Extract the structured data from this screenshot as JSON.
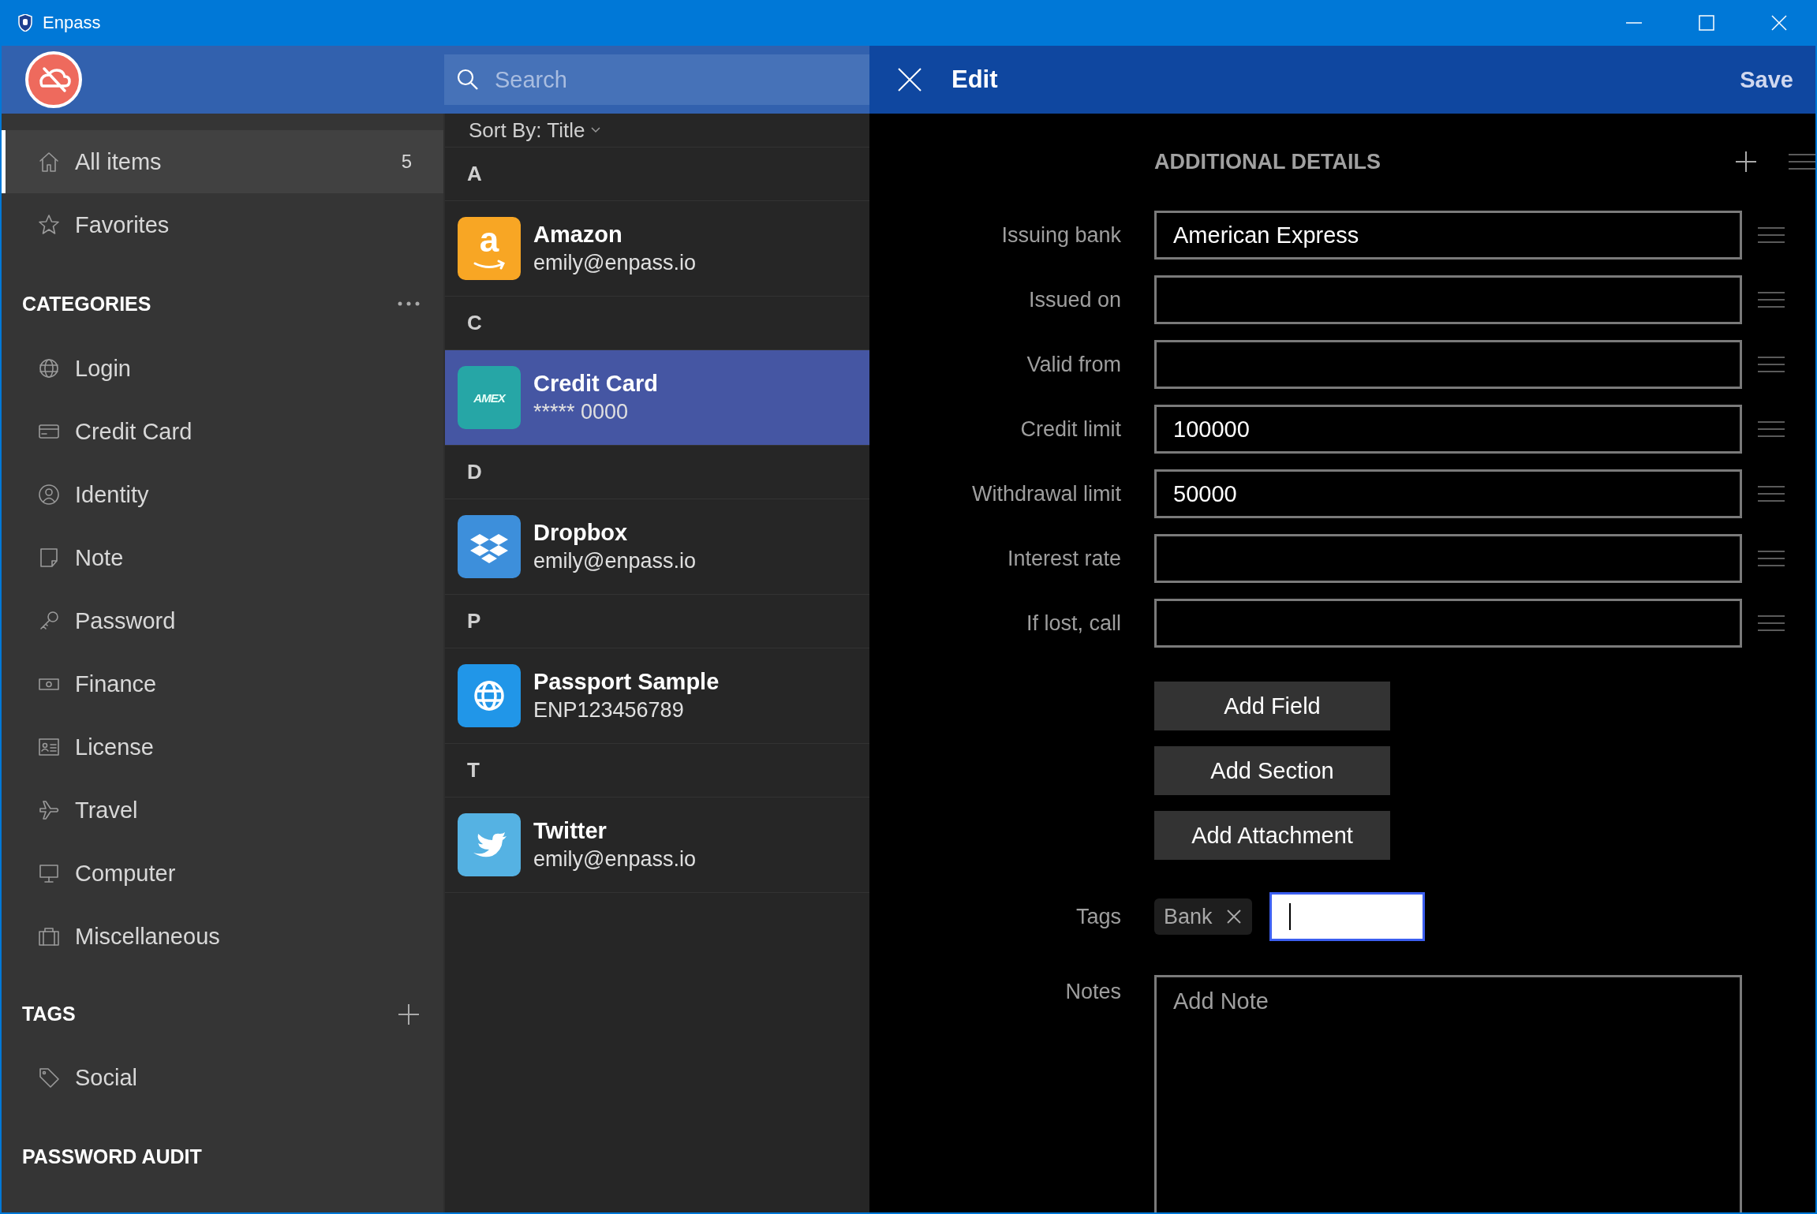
{
  "window": {
    "title": "Enpass"
  },
  "header": {
    "search": {
      "placeholder": "Search"
    }
  },
  "sidebar": {
    "items": [
      {
        "label": "All items",
        "count": "5",
        "selected": true
      },
      {
        "label": "Favorites",
        "selected": false
      }
    ],
    "categories_title": "CATEGORIES",
    "categories": [
      {
        "label": "Login",
        "selected": false
      },
      {
        "label": "Credit Card",
        "selected": false
      },
      {
        "label": "Identity",
        "selected": false
      },
      {
        "label": "Note",
        "selected": false
      },
      {
        "label": "Password",
        "selected": false
      },
      {
        "label": "Finance",
        "selected": false
      },
      {
        "label": "License",
        "selected": false
      },
      {
        "label": "Travel",
        "selected": false
      },
      {
        "label": "Computer",
        "selected": false
      },
      {
        "label": "Miscellaneous",
        "selected": false
      }
    ],
    "tags_title": "TAGS",
    "tags": [
      {
        "label": "Social",
        "selected": false
      }
    ],
    "password_audit_title": "PASSWORD AUDIT"
  },
  "list": {
    "sort": "Sort By: Title",
    "groups": [
      {
        "letter": "A",
        "items": [
          {
            "title": "Amazon",
            "subtitle": "emily@enpass.io",
            "badge_text": "a",
            "color": "#f8a624",
            "selected": false
          }
        ]
      },
      {
        "letter": "C",
        "items": [
          {
            "title": "Credit Card",
            "subtitle": "***** 0000",
            "badge_text": "AMEX",
            "color": "#26a6a6",
            "selected": true
          }
        ]
      },
      {
        "letter": "D",
        "items": [
          {
            "title": "Dropbox",
            "subtitle": "emily@enpass.io",
            "color": "#3d8fdb",
            "selected": false
          }
        ]
      },
      {
        "letter": "P",
        "items": [
          {
            "title": "Passport Sample",
            "subtitle": "ENP123456789",
            "color": "#2196e8",
            "selected": false
          }
        ]
      },
      {
        "letter": "T",
        "items": [
          {
            "title": "Twitter",
            "subtitle": "emily@enpass.io",
            "color": "#55b2e3",
            "selected": false
          }
        ]
      }
    ]
  },
  "edit": {
    "title": "Edit",
    "save": "Save",
    "section_title": "ADDITIONAL DETAILS",
    "fields": [
      {
        "label": "Issuing bank",
        "value": "American Express"
      },
      {
        "label": "Issued on"
      },
      {
        "label": "Valid from"
      },
      {
        "label": "Credit limit",
        "value": "100000"
      },
      {
        "label": "Withdrawal limit",
        "value": "50000"
      },
      {
        "label": "Interest rate"
      },
      {
        "label": "If lost, call"
      }
    ],
    "buttons": [
      "Add Field",
      "Add Section",
      "Add Attachment"
    ],
    "tags": {
      "label": "Tags",
      "chips": [
        "Bank"
      ],
      "input_focused": true
    },
    "notes": {
      "label": "Notes",
      "placeholder": "Add Note"
    }
  }
}
